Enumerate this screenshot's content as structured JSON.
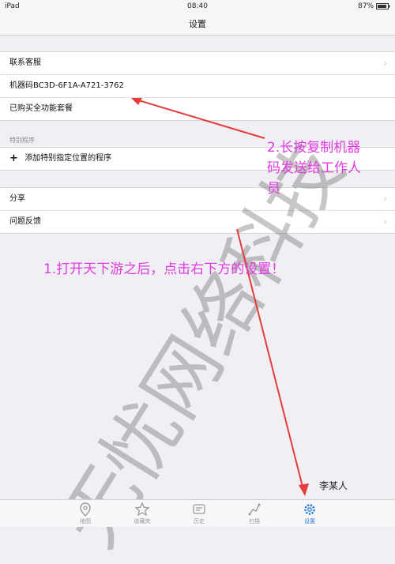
{
  "status_bar": {
    "device": "iPad",
    "time": "08:40",
    "battery": "87%"
  },
  "nav": {
    "title": "设置"
  },
  "groups": {
    "contact": {
      "rows": [
        {
          "label": "联系客服"
        },
        {
          "label": "机器码BC3D-6F1A-A721-3762"
        },
        {
          "label": "已购买全功能套餐"
        }
      ]
    },
    "special": {
      "header": "特别程序",
      "add_label": "添加特别指定位置的程序"
    },
    "more": {
      "rows": [
        {
          "label": "分享"
        },
        {
          "label": "问题反馈"
        }
      ]
    }
  },
  "annotations": {
    "step1": "1.打开天下游之后，点击右下方的设置！",
    "step2_line1": "2.长按复制机器",
    "step2_line2": "码发送给工作人",
    "step2_line3": "员",
    "color": "#e03ae0"
  },
  "watermark": {
    "text": "无忧网络科技"
  },
  "caption": "李某人",
  "tabs": [
    {
      "label": "地图",
      "icon": "map-pin-icon"
    },
    {
      "label": "收藏夹",
      "icon": "star-icon"
    },
    {
      "label": "历史",
      "icon": "history-icon"
    },
    {
      "label": "扫描",
      "icon": "route-icon"
    },
    {
      "label": "设置",
      "icon": "gear-icon",
      "active": true
    }
  ],
  "accent_color": "#2e7de1"
}
